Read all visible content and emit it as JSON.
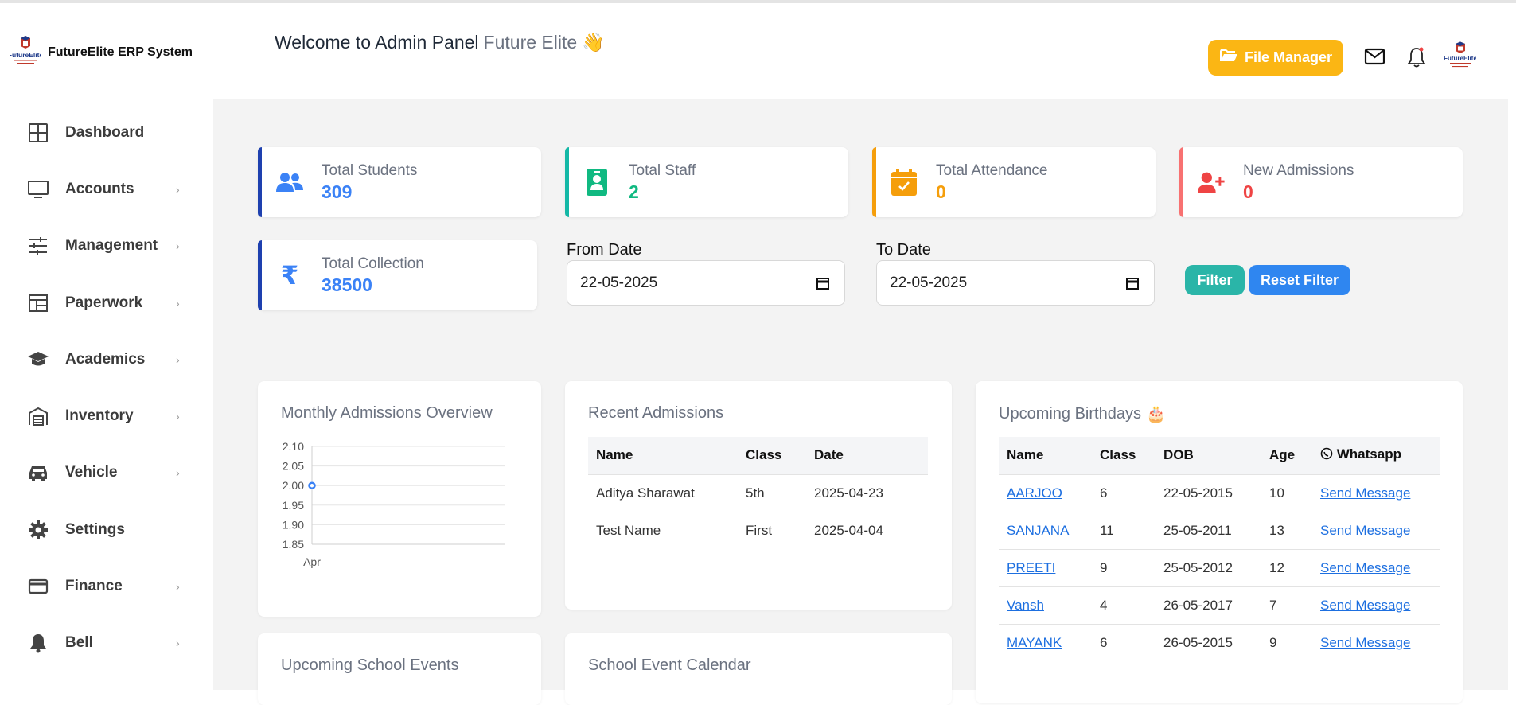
{
  "brand": {
    "name": "FutureElite ERP System",
    "logo_text": "FutureElite"
  },
  "sidebar": {
    "items": [
      {
        "label": "Dashboard",
        "icon": "grid-icon",
        "has_submenu": false
      },
      {
        "label": "Accounts",
        "icon": "monitor-icon",
        "has_submenu": true
      },
      {
        "label": "Management",
        "icon": "sliders-icon",
        "has_submenu": true
      },
      {
        "label": "Paperwork",
        "icon": "layout-icon",
        "has_submenu": true
      },
      {
        "label": "Academics",
        "icon": "graduation-cap-icon",
        "has_submenu": true
      },
      {
        "label": "Inventory",
        "icon": "warehouse-icon",
        "has_submenu": true
      },
      {
        "label": "Vehicle",
        "icon": "car-icon",
        "has_submenu": true
      },
      {
        "label": "Settings",
        "icon": "gear-icon",
        "has_submenu": false
      },
      {
        "label": "Finance",
        "icon": "credit-card-icon",
        "has_submenu": true
      },
      {
        "label": "Bell",
        "icon": "bell-icon",
        "has_submenu": true
      }
    ],
    "chevron": "›"
  },
  "header": {
    "welcome_prefix": "Welcome to Admin Panel",
    "welcome_brand": "Future Elite",
    "wave": "👋",
    "file_manager_label": "File Manager"
  },
  "stats": {
    "students": {
      "label": "Total Students",
      "value": "309",
      "color": "#3b82f6"
    },
    "staff": {
      "label": "Total Staff",
      "value": "2",
      "color": "#10b981"
    },
    "attendance": {
      "label": "Total Attendance",
      "value": "0",
      "color": "#f59e0b"
    },
    "admissions": {
      "label": "New Admissions",
      "value": "0",
      "color": "#ef4444"
    },
    "collection": {
      "label": "Total Collection",
      "value": "38500",
      "color": "#3b82f6"
    }
  },
  "filters": {
    "from_label": "From Date",
    "from_value": "22-05-2025",
    "to_label": "To Date",
    "to_value": "22-05-2025",
    "filter_label": "Filter",
    "reset_label": "Reset Filter"
  },
  "monthly_chart": {
    "title": "Monthly Admissions Overview"
  },
  "chart_data": {
    "type": "line",
    "x": [
      "Apr"
    ],
    "series": [
      {
        "values": [
          2
        ]
      }
    ],
    "yticks": [
      "2.10",
      "2.05",
      "2.00",
      "1.95",
      "1.90",
      "1.85"
    ],
    "ylim": [
      1.85,
      2.1
    ],
    "grid": true,
    "color": "#3b82f6"
  },
  "recent_admissions": {
    "title": "Recent Admissions",
    "headers": [
      "Name",
      "Class",
      "Date"
    ],
    "rows": [
      [
        "Aditya Sharawat",
        "5th",
        "2025-04-23"
      ],
      [
        "Test Name",
        "First",
        "2025-04-04"
      ]
    ]
  },
  "birthdays": {
    "title": "Upcoming Birthdays",
    "cake": "🎂",
    "headers": [
      "Name",
      "Class",
      "DOB",
      "Age",
      "Whatsapp"
    ],
    "rows": [
      [
        "AARJOO",
        "6",
        "22-05-2015",
        "10",
        "Send Message"
      ],
      [
        "SANJANA",
        "11",
        "25-05-2011",
        "13",
        "Send Message"
      ],
      [
        "PREETI",
        "9",
        "25-05-2012",
        "12",
        "Send Message"
      ],
      [
        "Vansh",
        "4",
        "26-05-2017",
        "7",
        "Send Message"
      ],
      [
        "MAYANK",
        "6",
        "26-05-2015",
        "9",
        "Send Message"
      ]
    ]
  },
  "events": {
    "title": "Upcoming School Events"
  },
  "calendar": {
    "title": "School Event Calendar"
  }
}
